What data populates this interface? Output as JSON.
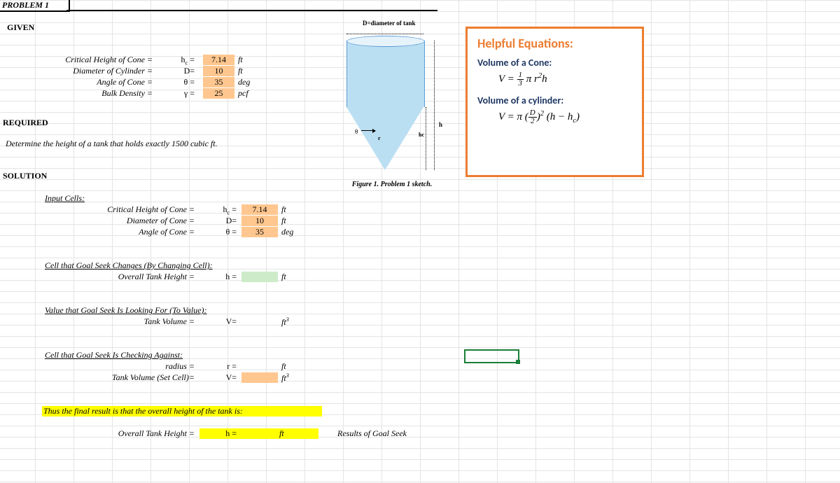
{
  "title": "PROBLEM 1",
  "sections": {
    "given": "GIVEN",
    "required": "REQUIRED",
    "required_text": "Determine the height of a tank that holds exactly 1500 cubic ft.",
    "solution": "SOLUTION"
  },
  "given_rows": [
    {
      "label": "Critical Height of Cone =",
      "sym_pre": "h",
      "sym_sub": "c",
      "sym_post": " =",
      "value": "7.14",
      "unit": "ft"
    },
    {
      "label": "Diameter of Cylinder =",
      "sym": "D=",
      "value": "10",
      "unit": "ft"
    },
    {
      "label": "Angle of Cone =",
      "sym": "θ =",
      "value": "35",
      "unit": "deg"
    },
    {
      "label": "Bulk Density =",
      "sym": "γ =",
      "value": "25",
      "unit": "pcf"
    }
  ],
  "sol": {
    "input_hdr": "Input Cells:",
    "rows": [
      {
        "label": "Critical Height of Cone =",
        "sym_pre": "h",
        "sym_sub": "c",
        "sym_post": " =",
        "value": "7.14",
        "unit": "ft"
      },
      {
        "label": "Diameter of Cone =",
        "sym": "D=",
        "value": "10",
        "unit": "ft"
      },
      {
        "label": "Angle of Cone =",
        "sym": "θ =",
        "value": "35",
        "unit": "deg"
      }
    ],
    "chg_hdr": "Cell that Goal Seek Changes (By Changing Cell):",
    "chg": {
      "label": "Overall Tank Height =",
      "sym": "h =",
      "value": "",
      "unit": "ft"
    },
    "look_hdr": "Value that Goal Seek Is Looking For (To Value):",
    "look": {
      "label": "Tank Volume =",
      "sym": "V=",
      "value": "",
      "unit_pre": "ft",
      "unit_sup": "3"
    },
    "chk_hdr": "Cell that Goal Seek Is Checking Against:",
    "chk1": {
      "label": "radius =",
      "sym": "r =",
      "value": "",
      "unit": "ft"
    },
    "chk2": {
      "label": "Tank Volume (Set Cell)=",
      "sym": "V=",
      "value": "",
      "unit_pre": "ft",
      "unit_sup": "3"
    },
    "final_hdr": "Thus the final result is that the overall height of the tank is:",
    "final": {
      "label": "Overall Tank Height =",
      "sym": "h =",
      "value": "",
      "unit": "ft"
    },
    "final_note": "Results of Goal Seek"
  },
  "sketch": {
    "d_label": "D=diameter of tank",
    "theta": "θ",
    "r": "r",
    "h": "h",
    "hc": "hc",
    "caption": "Figure 1. Problem 1 sketch."
  },
  "eq": {
    "title": "Helpful Equations:",
    "cone_hdr": "Volume of a Cone:",
    "cyl_hdr": "Volume of a cylinder:"
  }
}
